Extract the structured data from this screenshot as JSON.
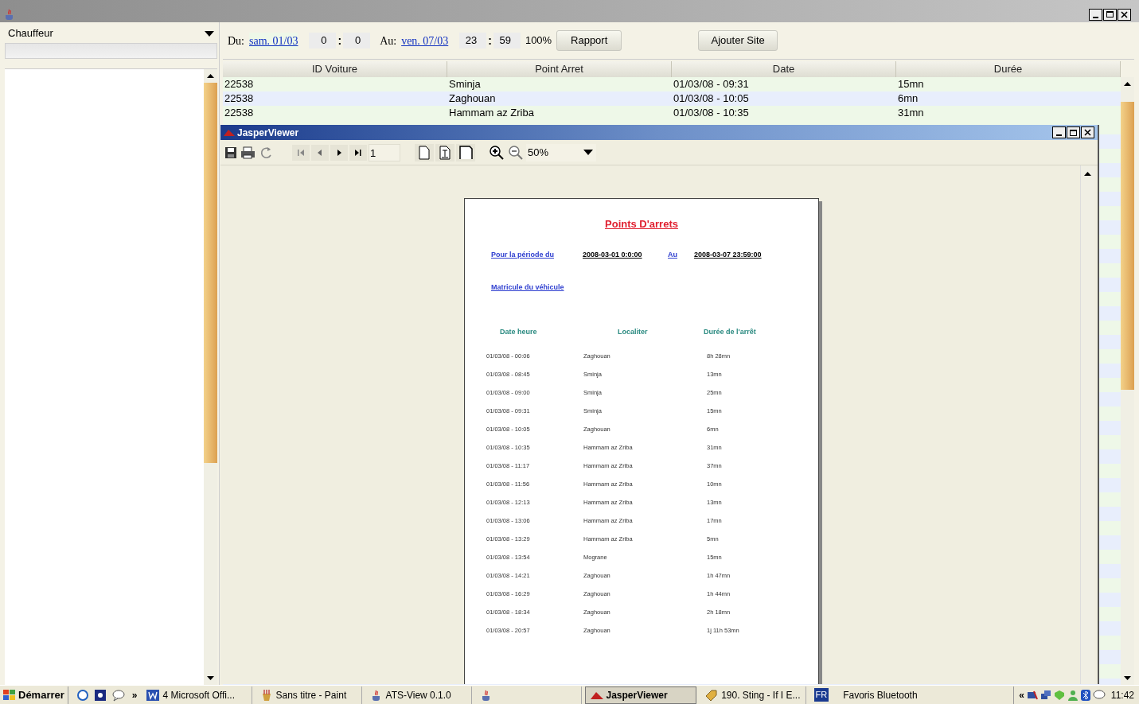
{
  "sidebar": {
    "dropdown": {
      "value": "Chauffeur"
    }
  },
  "toolbar": {
    "from_label": "Du:",
    "from_date": "sam. 01/03",
    "from_hour": "0",
    "time_separator": ":",
    "from_minute": "0",
    "to_label": "Au:",
    "to_date": "ven. 07/03",
    "to_hour": "23",
    "to_minute": "59",
    "zoom": "100%",
    "buttons": [
      "Rapport",
      "Ajouter Site"
    ]
  },
  "table": {
    "columns": [
      "ID Voiture",
      "Point Arret",
      "Date",
      "Durée"
    ],
    "rows": [
      [
        "22538",
        "Sminja",
        "01/03/08 - 09:31",
        "15mn"
      ],
      [
        "22538",
        "Zaghouan",
        "01/03/08 - 10:05",
        "6mn"
      ],
      [
        "22538",
        "Hammam az Zriba",
        "01/03/08 - 10:35",
        "31mn"
      ]
    ]
  },
  "viewer": {
    "title": "JasperViewer",
    "page_number": "1",
    "zoom": "50%",
    "report": {
      "title": "Points D'arrets",
      "period_label": "Pour la période du",
      "start": "2008-03-01 0:0:00",
      "to_label": "Au",
      "end": "2008-03-07 23:59:00",
      "vehicle_label": "Matricule du véhicule",
      "columns": [
        "Date heure",
        "Localiter",
        "Durée de l'arrêt"
      ],
      "rows": [
        [
          "01/03/08 - 00:06",
          "Zaghouan",
          "8h 28mn"
        ],
        [
          "01/03/08 - 08:45",
          "Sminja",
          "13mn"
        ],
        [
          "01/03/08 - 09:00",
          "Sminja",
          "25mn"
        ],
        [
          "01/03/08 - 09:31",
          "Sminja",
          "15mn"
        ],
        [
          "01/03/08 - 10:05",
          "Zaghouan",
          "6mn"
        ],
        [
          "01/03/08 - 10:35",
          "Hammam az Zriba",
          "31mn"
        ],
        [
          "01/03/08 - 11:17",
          "Hammam az Zriba",
          "37mn"
        ],
        [
          "01/03/08 - 11:56",
          "Hammam az Zriba",
          "10mn"
        ],
        [
          "01/03/08 - 12:13",
          "Hammam az Zriba",
          "13mn"
        ],
        [
          "01/03/08 - 13:06",
          "Hammam az Zriba",
          "17mn"
        ],
        [
          "01/03/08 - 13:29",
          "Hammam az Zriba",
          "5mn"
        ],
        [
          "01/03/08 - 13:54",
          "Mograne",
          "15mn"
        ],
        [
          "01/03/08 - 14:21",
          "Zaghouan",
          "1h 47mn"
        ],
        [
          "01/03/08 - 16:29",
          "Zaghouan",
          "1h 44mn"
        ],
        [
          "01/03/08 - 18:34",
          "Zaghouan",
          "2h 18mn"
        ],
        [
          "01/03/08 - 20:57",
          "Zaghouan",
          "1j 11h 53mn"
        ]
      ]
    }
  },
  "taskbar": {
    "start": "Démarrer",
    "more": "»",
    "tasks": [
      {
        "kind": "word",
        "label": "4 Microsoft Offi...",
        "selected": false
      },
      {
        "kind": "paint",
        "label": "Sans titre - Paint",
        "selected": false
      },
      {
        "kind": "java",
        "label": "ATS-View 0.1.0",
        "selected": false
      },
      {
        "kind": "java",
        "selected": false
      },
      {
        "kind": "jasper",
        "label": "JasperViewer",
        "selected": true
      },
      {
        "kind": "media",
        "label": "190. Sting - If I E...",
        "selected": false
      }
    ],
    "language": "FR",
    "toolbar_label": "Favoris Bluetooth",
    "tray_expand": "«",
    "clock": "11:42"
  }
}
